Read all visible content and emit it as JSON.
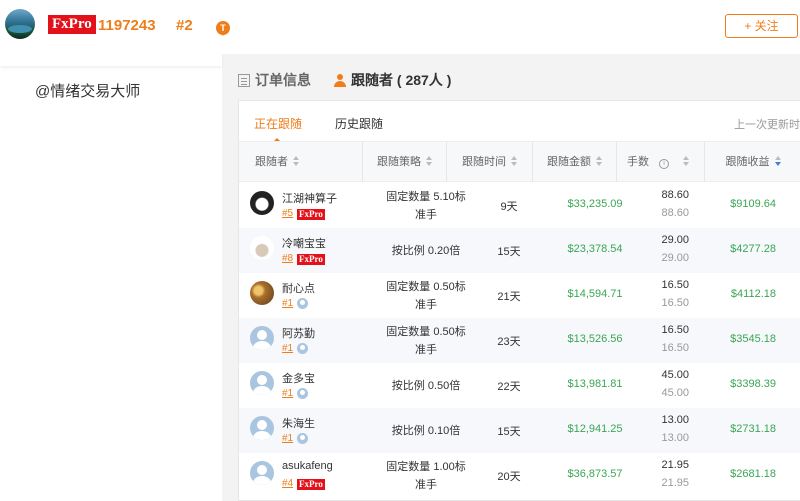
{
  "header": {
    "broker_logo": "FxPro",
    "account_id": "1197243",
    "rank": "#2",
    "badge_letter": "T",
    "follow_button": "+ 关注"
  },
  "profile": {
    "nickname": "@情绪交易大师"
  },
  "section_tabs": [
    {
      "label": "订单信息",
      "icon": "document-icon",
      "active": false
    },
    {
      "label": "跟随者 ( 287人 )",
      "icon": "person-icon",
      "active": true
    }
  ],
  "sub_tabs": [
    {
      "label": "正在跟随",
      "active": true
    },
    {
      "label": "历史跟随",
      "active": false
    }
  ],
  "last_update_label": "上一次更新时",
  "columns": [
    "跟随者",
    "跟随策略",
    "跟随时间",
    "跟随金额",
    "手数",
    "跟随收益"
  ],
  "rows": [
    {
      "name": "江湖神算子",
      "rank": "#5",
      "tag": "FxPro",
      "avatar": "a1",
      "strategy": [
        "固定数量 5.10标",
        "准手"
      ],
      "days": "9天",
      "amount": "$33,235.09",
      "lots": "88.60",
      "lots2": "88.60",
      "profit": "$9109.64"
    },
    {
      "name": "冷嘲宝宝",
      "rank": "#8",
      "tag": "FxPro",
      "avatar": "a2",
      "strategy": [
        "按比例 0.20倍"
      ],
      "days": "15天",
      "amount": "$23,378.54",
      "lots": "29.00",
      "lots2": "29.00",
      "profit": "$4277.28"
    },
    {
      "name": "耐心点",
      "rank": "#1",
      "tag": "mini-avatar",
      "avatar": "a3",
      "strategy": [
        "固定数量 0.50标",
        "准手"
      ],
      "days": "21天",
      "amount": "$14,594.71",
      "lots": "16.50",
      "lots2": "16.50",
      "profit": "$4112.18"
    },
    {
      "name": "阿苏勤",
      "rank": "#1",
      "tag": "mini-avatar",
      "avatar": "default",
      "strategy": [
        "固定数量 0.50标",
        "准手"
      ],
      "days": "23天",
      "amount": "$13,526.56",
      "lots": "16.50",
      "lots2": "16.50",
      "profit": "$3545.18"
    },
    {
      "name": "金多宝",
      "rank": "#1",
      "tag": "mini-avatar",
      "avatar": "default",
      "strategy": [
        "按比例 0.50倍"
      ],
      "days": "22天",
      "amount": "$13,981.81",
      "lots": "45.00",
      "lots2": "45.00",
      "profit": "$3398.39"
    },
    {
      "name": "朱海生",
      "rank": "#1",
      "tag": "mini-avatar",
      "avatar": "default",
      "strategy": [
        "按比例 0.10倍"
      ],
      "days": "15天",
      "amount": "$12,941.25",
      "lots": "13.00",
      "lots2": "13.00",
      "profit": "$2731.18"
    },
    {
      "name": "asukafeng",
      "rank": "#4",
      "tag": "FxPro",
      "avatar": "default",
      "strategy": [
        "固定数量 1.00标",
        "准手"
      ],
      "days": "20天",
      "amount": "$36,873.57",
      "lots": "21.95",
      "lots2": "21.95",
      "profit": "$2681.18"
    }
  ],
  "colors": {
    "accent": "#ef7d1a",
    "brand_red": "#e3111a",
    "profit_green": "#3aa655"
  }
}
